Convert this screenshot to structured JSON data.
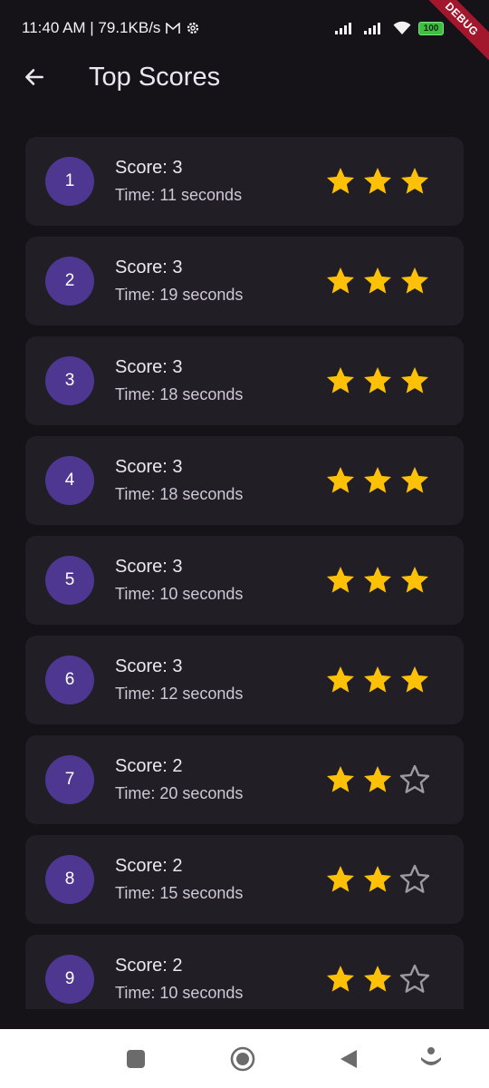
{
  "status_bar": {
    "time": "11:40 AM | 79.1KB/s",
    "battery": "100",
    "debug_label": "DEBUG"
  },
  "app_bar": {
    "title": "Top Scores"
  },
  "scores": [
    {
      "rank": "1",
      "score": "Score: 3",
      "time": "Time: 11 seconds",
      "stars": 3
    },
    {
      "rank": "2",
      "score": "Score: 3",
      "time": "Time: 19 seconds",
      "stars": 3
    },
    {
      "rank": "3",
      "score": "Score: 3",
      "time": "Time: 18 seconds",
      "stars": 3
    },
    {
      "rank": "4",
      "score": "Score: 3",
      "time": "Time: 18 seconds",
      "stars": 3
    },
    {
      "rank": "5",
      "score": "Score: 3",
      "time": "Time: 10 seconds",
      "stars": 3
    },
    {
      "rank": "6",
      "score": "Score: 3",
      "time": "Time: 12 seconds",
      "stars": 3
    },
    {
      "rank": "7",
      "score": "Score: 2",
      "time": "Time: 20 seconds",
      "stars": 2
    },
    {
      "rank": "8",
      "score": "Score: 2",
      "time": "Time: 15 seconds",
      "stars": 2
    },
    {
      "rank": "9",
      "score": "Score: 2",
      "time": "Time: 10 seconds",
      "stars": 2
    }
  ],
  "max_stars": 3,
  "colors": {
    "background": "#151218",
    "card": "#211e25",
    "rank_badge": "#4d3791",
    "star_filled": "#ffc107",
    "star_empty_outline": "#9e9aa3"
  },
  "icons": {
    "back": "arrow-back-icon",
    "star_filled": "star-filled-icon",
    "star_empty": "star-outline-icon"
  }
}
